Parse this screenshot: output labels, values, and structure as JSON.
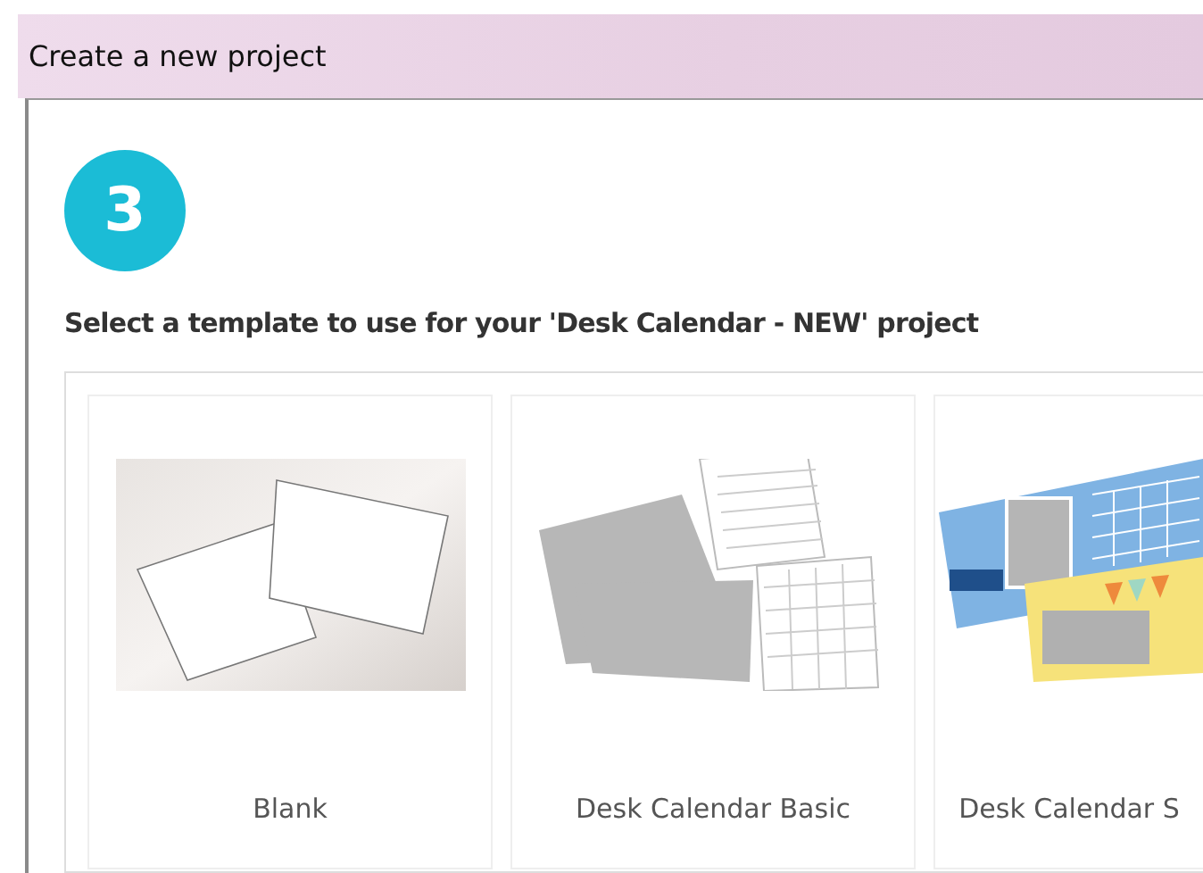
{
  "window": {
    "title": "Create a new project"
  },
  "step": {
    "number": "3"
  },
  "heading": "Select a template to use for your 'Desk Calendar - NEW' project",
  "templates": [
    {
      "label": "Blank",
      "kind": "blank"
    },
    {
      "label": "Desk Calendar Basic",
      "kind": "basic"
    },
    {
      "label": "Desk Calendar S",
      "kind": "design"
    }
  ]
}
